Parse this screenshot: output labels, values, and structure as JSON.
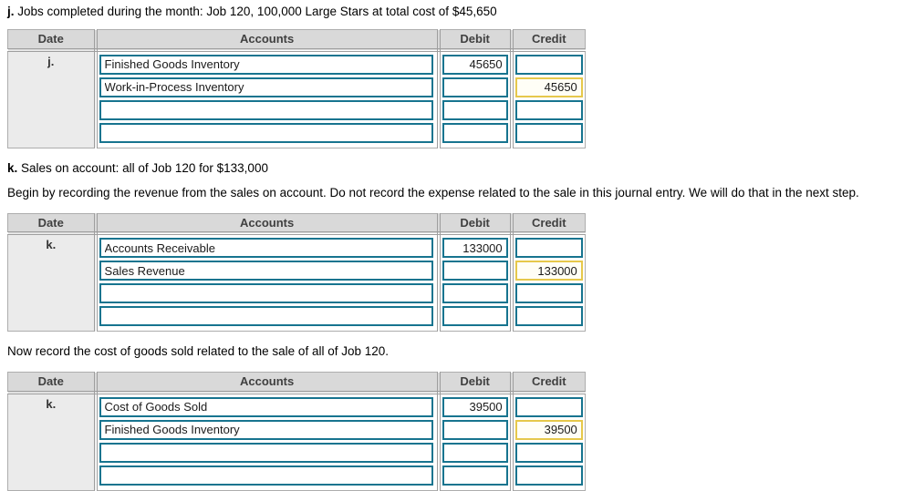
{
  "colors": {
    "input_border": "#17748f",
    "highlight_border": "#e6c84b",
    "highlight_bg": "#fffef6",
    "header_bg": "#d9d9d9",
    "date_col_bg": "#ebebeb",
    "grid_line": "#9e9e9e"
  },
  "headers": {
    "date": "Date",
    "accounts": "Accounts",
    "debit": "Debit",
    "credit": "Credit"
  },
  "intro": {
    "j_label": "j.",
    "j_text": " Jobs completed during the month: Job 120, 100,000 Large Stars at total cost of $45,650",
    "k_label": "k.",
    "k_text": " Sales on account: all of Job 120 for $133,000",
    "revenue_instruction": "Begin by recording the revenue from the sales on account. Do not record the expense related to the sale in this journal entry. We will do that in the next step.",
    "cogs_instruction": "Now record the cost of goods sold related to the sale of all of Job 120."
  },
  "tables": [
    {
      "date_label": "j.",
      "rows": [
        {
          "account": "Finished Goods Inventory",
          "debit": "45650",
          "credit": ""
        },
        {
          "account": "Work-in-Process Inventory",
          "debit": "",
          "credit": "45650"
        },
        {
          "account": "",
          "debit": "",
          "credit": ""
        },
        {
          "account": "",
          "debit": "",
          "credit": ""
        }
      ]
    },
    {
      "date_label": "k.",
      "rows": [
        {
          "account": "Accounts Receivable",
          "debit": "133000",
          "credit": ""
        },
        {
          "account": "Sales Revenue",
          "debit": "",
          "credit": "133000"
        },
        {
          "account": "",
          "debit": "",
          "credit": ""
        },
        {
          "account": "",
          "debit": "",
          "credit": ""
        }
      ]
    },
    {
      "date_label": "k.",
      "rows": [
        {
          "account": "Cost of Goods Sold",
          "debit": "39500",
          "credit": ""
        },
        {
          "account": "Finished Goods Inventory",
          "debit": "",
          "credit": "39500"
        },
        {
          "account": "",
          "debit": "",
          "credit": ""
        },
        {
          "account": "",
          "debit": "",
          "credit": ""
        }
      ]
    }
  ]
}
